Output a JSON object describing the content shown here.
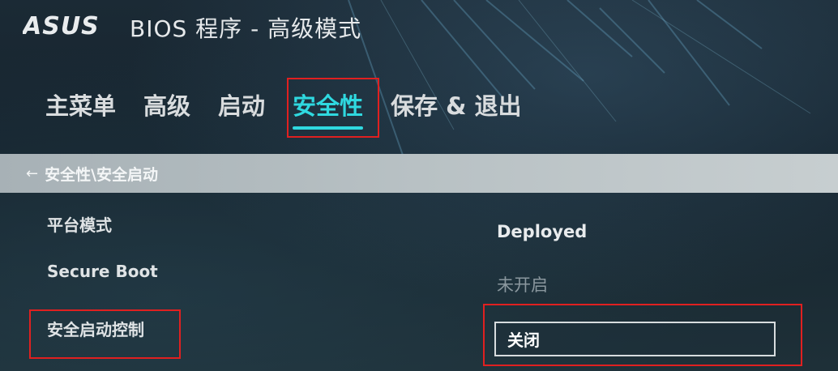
{
  "header": {
    "logo_text": "ASUS",
    "title": "BIOS 程序 - 高级模式"
  },
  "tabs": [
    {
      "label": "主菜单",
      "active": false
    },
    {
      "label": "高级",
      "active": false
    },
    {
      "label": "启动",
      "active": false
    },
    {
      "label": "安全性",
      "active": true
    },
    {
      "label": "保存 & 退出",
      "active": false
    }
  ],
  "breadcrumb": {
    "back_icon": "left-arrow-icon",
    "path": "安全性\\安全启动"
  },
  "settings": [
    {
      "label": "平台模式",
      "value": "Deployed"
    },
    {
      "label": "Secure Boot",
      "value": "未开启"
    },
    {
      "label": "安全启动控制",
      "value": "关闭"
    }
  ],
  "colors": {
    "accent": "#2fd9e0",
    "highlight_annotation": "#e02020",
    "breadcrumb_bar": "#b8c1c4"
  }
}
